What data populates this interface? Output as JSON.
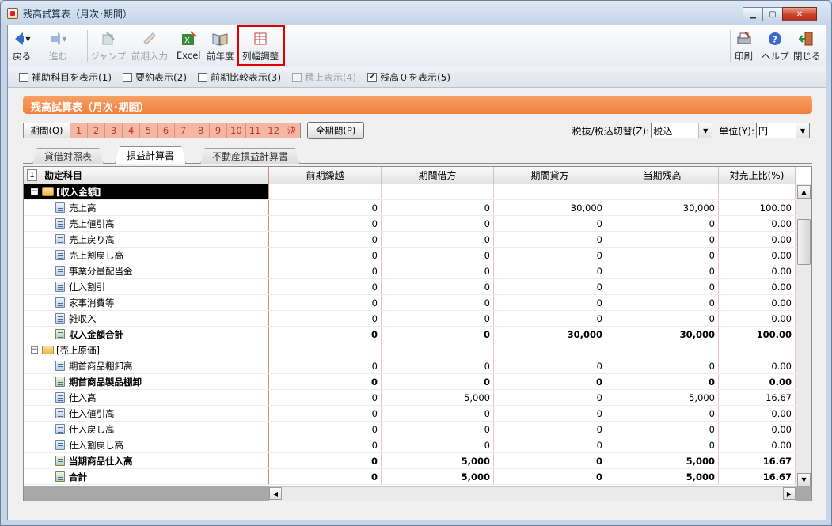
{
  "window": {
    "title": "残高試算表（月次･期間）"
  },
  "toolbar": {
    "back": "戻る",
    "forward": "進む",
    "jump": "ジャンプ",
    "prev_entry": "前期入力",
    "excel": "Excel",
    "prev_year": "前年度",
    "col_width": "列幅調整",
    "print": "印刷",
    "help": "ヘルプ",
    "close": "閉じる"
  },
  "options": [
    {
      "label": "補助科目を表示(1)",
      "checked": false,
      "enabled": true
    },
    {
      "label": "要約表示(2)",
      "checked": false,
      "enabled": true
    },
    {
      "label": "前期比較表示(3)",
      "checked": false,
      "enabled": true
    },
    {
      "label": "積上表示(4)",
      "checked": false,
      "enabled": false
    },
    {
      "label": "残高０を表示(5)",
      "checked": true,
      "enabled": true
    }
  ],
  "heading": "残高試算表（月次･期間）",
  "period": {
    "label": "期間(Q)",
    "months": [
      "1",
      "2",
      "3",
      "4",
      "5",
      "6",
      "7",
      "8",
      "9",
      "10",
      "11",
      "12",
      "決"
    ],
    "all_button": "全期間(P)"
  },
  "tax": {
    "label": "税抜/税込切替(Z):",
    "value": "税込",
    "unit_label": "単位(Y):",
    "unit_value": "円"
  },
  "tabs": [
    "貸借対照表",
    "損益計算書",
    "不動産損益計算書"
  ],
  "active_tab": 1,
  "grid": {
    "corner_number": "1",
    "columns": [
      "勘定科目",
      "前期繰越",
      "期間借方",
      "期間貸方",
      "当期残高",
      "対売上比(%)"
    ],
    "rows": [
      {
        "type": "group",
        "name": "[収入金額]",
        "selected": true,
        "values": [
          "",
          "",
          "",
          "",
          ""
        ]
      },
      {
        "type": "item",
        "name": "売上高",
        "values": [
          "0",
          "0",
          "30,000",
          "30,000",
          "100.00"
        ]
      },
      {
        "type": "item",
        "name": "売上値引高",
        "values": [
          "0",
          "0",
          "0",
          "0",
          "0.00"
        ]
      },
      {
        "type": "item",
        "name": "売上戻り高",
        "values": [
          "0",
          "0",
          "0",
          "0",
          "0.00"
        ]
      },
      {
        "type": "item",
        "name": "売上割戻し高",
        "values": [
          "0",
          "0",
          "0",
          "0",
          "0.00"
        ]
      },
      {
        "type": "item",
        "name": "事業分量配当金",
        "values": [
          "0",
          "0",
          "0",
          "0",
          "0.00"
        ]
      },
      {
        "type": "item",
        "name": "仕入割引",
        "values": [
          "0",
          "0",
          "0",
          "0",
          "0.00"
        ]
      },
      {
        "type": "item",
        "name": "家事消費等",
        "values": [
          "0",
          "0",
          "0",
          "0",
          "0.00"
        ]
      },
      {
        "type": "item",
        "name": "雑収入",
        "values": [
          "0",
          "0",
          "0",
          "0",
          "0.00"
        ]
      },
      {
        "type": "sum",
        "name": "収入金額合計",
        "values": [
          "0",
          "0",
          "30,000",
          "30,000",
          "100.00"
        ]
      },
      {
        "type": "group",
        "name": "[売上原価]",
        "selected": false,
        "values": [
          "",
          "",
          "",
          "",
          ""
        ]
      },
      {
        "type": "item",
        "name": "期首商品棚卸高",
        "values": [
          "0",
          "0",
          "0",
          "0",
          "0.00"
        ]
      },
      {
        "type": "sum",
        "name": "期首商品製品棚卸",
        "values": [
          "0",
          "0",
          "0",
          "0",
          "0.00"
        ]
      },
      {
        "type": "item",
        "name": "仕入高",
        "values": [
          "0",
          "5,000",
          "0",
          "5,000",
          "16.67"
        ]
      },
      {
        "type": "item",
        "name": "仕入値引高",
        "values": [
          "0",
          "0",
          "0",
          "0",
          "0.00"
        ]
      },
      {
        "type": "item",
        "name": "仕入戻し高",
        "values": [
          "0",
          "0",
          "0",
          "0",
          "0.00"
        ]
      },
      {
        "type": "item",
        "name": "仕入割戻し高",
        "values": [
          "0",
          "0",
          "0",
          "0",
          "0.00"
        ]
      },
      {
        "type": "sum",
        "name": "当期商品仕入高",
        "values": [
          "0",
          "5,000",
          "0",
          "5,000",
          "16.67"
        ]
      },
      {
        "type": "sum",
        "name": "合計",
        "values": [
          "0",
          "5,000",
          "0",
          "5,000",
          "16.67"
        ]
      }
    ]
  },
  "colors": {
    "accent": "#f07f3c",
    "highlight_box": "#e00000"
  }
}
